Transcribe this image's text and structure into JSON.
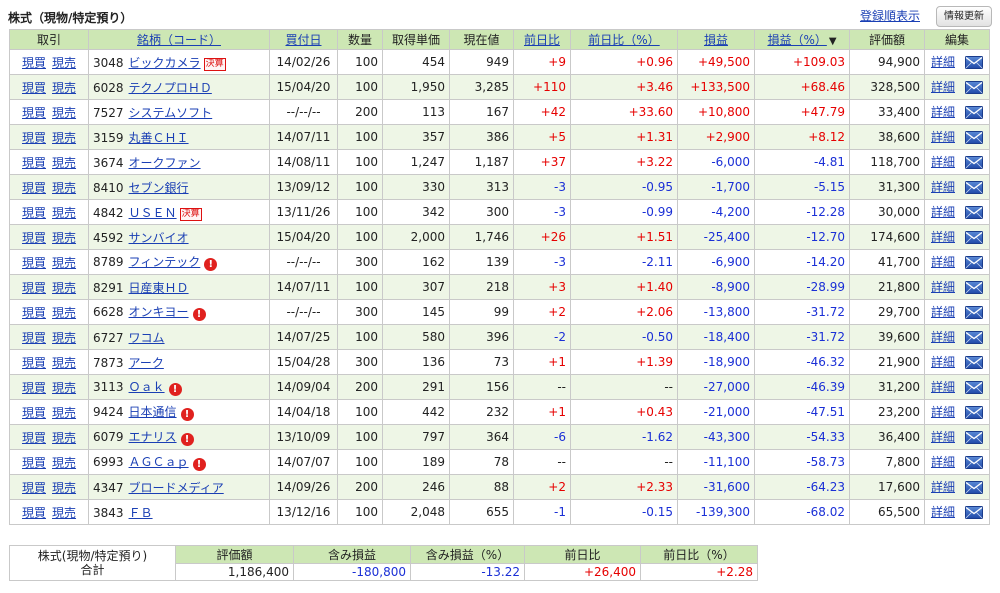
{
  "page": {
    "title": "株式（現物/特定預り）",
    "sort_link": "登録順表示",
    "refresh_button": "情報更新"
  },
  "columns": [
    "取引",
    "銘柄（コード）",
    "買付日",
    "数量",
    "取得単価",
    "現在値",
    "前日比",
    "前日比（%）",
    "損益",
    "損益（%）",
    "評価額",
    "編集"
  ],
  "sort_indicator": "▼",
  "trade_labels": {
    "buy": "現買",
    "sell": "現売"
  },
  "detail_label": "詳細",
  "settle_badge": "決算",
  "alert_symbol": "!",
  "rows": [
    {
      "code": "3048",
      "name": "ビックカメラ",
      "badge": "settle",
      "date": "14/02/26",
      "qty": "100",
      "cost": "454",
      "price": "949",
      "chg": "+9",
      "chg_pct": "+0.96",
      "pl": "+49,500",
      "pl_pct": "+109.03",
      "value": "94,900"
    },
    {
      "code": "6028",
      "name": "テクノプロＨＤ",
      "badge": "",
      "date": "15/04/20",
      "qty": "100",
      "cost": "1,950",
      "price": "3,285",
      "chg": "+110",
      "chg_pct": "+3.46",
      "pl": "+133,500",
      "pl_pct": "+68.46",
      "value": "328,500"
    },
    {
      "code": "7527",
      "name": "システムソフト",
      "badge": "",
      "date": "--/--/--",
      "qty": "200",
      "cost": "113",
      "price": "167",
      "chg": "+42",
      "chg_pct": "+33.60",
      "pl": "+10,800",
      "pl_pct": "+47.79",
      "value": "33,400"
    },
    {
      "code": "3159",
      "name": "丸善ＣＨＩ",
      "badge": "",
      "date": "14/07/11",
      "qty": "100",
      "cost": "357",
      "price": "386",
      "chg": "+5",
      "chg_pct": "+1.31",
      "pl": "+2,900",
      "pl_pct": "+8.12",
      "value": "38,600"
    },
    {
      "code": "3674",
      "name": "オークファン",
      "badge": "",
      "date": "14/08/11",
      "qty": "100",
      "cost": "1,247",
      "price": "1,187",
      "chg": "+37",
      "chg_pct": "+3.22",
      "pl": "-6,000",
      "pl_pct": "-4.81",
      "value": "118,700"
    },
    {
      "code": "8410",
      "name": "セブン銀行",
      "badge": "",
      "date": "13/09/12",
      "qty": "100",
      "cost": "330",
      "price": "313",
      "chg": "-3",
      "chg_pct": "-0.95",
      "pl": "-1,700",
      "pl_pct": "-5.15",
      "value": "31,300"
    },
    {
      "code": "4842",
      "name": "ＵＳＥＮ",
      "badge": "settle",
      "date": "13/11/26",
      "qty": "100",
      "cost": "342",
      "price": "300",
      "chg": "-3",
      "chg_pct": "-0.99",
      "pl": "-4,200",
      "pl_pct": "-12.28",
      "value": "30,000"
    },
    {
      "code": "4592",
      "name": "サンバイオ",
      "badge": "",
      "date": "15/04/20",
      "qty": "100",
      "cost": "2,000",
      "price": "1,746",
      "chg": "+26",
      "chg_pct": "+1.51",
      "pl": "-25,400",
      "pl_pct": "-12.70",
      "value": "174,600"
    },
    {
      "code": "8789",
      "name": "フィンテック",
      "badge": "alert",
      "date": "--/--/--",
      "qty": "300",
      "cost": "162",
      "price": "139",
      "chg": "-3",
      "chg_pct": "-2.11",
      "pl": "-6,900",
      "pl_pct": "-14.20",
      "value": "41,700"
    },
    {
      "code": "8291",
      "name": "日産東ＨＤ",
      "badge": "",
      "date": "14/07/11",
      "qty": "100",
      "cost": "307",
      "price": "218",
      "chg": "+3",
      "chg_pct": "+1.40",
      "pl": "-8,900",
      "pl_pct": "-28.99",
      "value": "21,800"
    },
    {
      "code": "6628",
      "name": "オンキヨー",
      "badge": "alert",
      "date": "--/--/--",
      "qty": "300",
      "cost": "145",
      "price": "99",
      "chg": "+2",
      "chg_pct": "+2.06",
      "pl": "-13,800",
      "pl_pct": "-31.72",
      "value": "29,700"
    },
    {
      "code": "6727",
      "name": "ワコム",
      "badge": "",
      "date": "14/07/25",
      "qty": "100",
      "cost": "580",
      "price": "396",
      "chg": "-2",
      "chg_pct": "-0.50",
      "pl": "-18,400",
      "pl_pct": "-31.72",
      "value": "39,600"
    },
    {
      "code": "7873",
      "name": "アーク",
      "badge": "",
      "date": "15/04/28",
      "qty": "300",
      "cost": "136",
      "price": "73",
      "chg": "+1",
      "chg_pct": "+1.39",
      "pl": "-18,900",
      "pl_pct": "-46.32",
      "value": "21,900"
    },
    {
      "code": "3113",
      "name": "Ｏａｋ",
      "badge": "alert",
      "date": "14/09/04",
      "qty": "200",
      "cost": "291",
      "price": "156",
      "chg": "--",
      "chg_pct": "--",
      "pl": "-27,000",
      "pl_pct": "-46.39",
      "value": "31,200"
    },
    {
      "code": "9424",
      "name": "日本通信",
      "badge": "alert",
      "date": "14/04/18",
      "qty": "100",
      "cost": "442",
      "price": "232",
      "chg": "+1",
      "chg_pct": "+0.43",
      "pl": "-21,000",
      "pl_pct": "-47.51",
      "value": "23,200"
    },
    {
      "code": "6079",
      "name": "エナリス",
      "badge": "alert",
      "date": "13/10/09",
      "qty": "100",
      "cost": "797",
      "price": "364",
      "chg": "-6",
      "chg_pct": "-1.62",
      "pl": "-43,300",
      "pl_pct": "-54.33",
      "value": "36,400"
    },
    {
      "code": "6993",
      "name": "ＡＧＣａｐ",
      "badge": "alert",
      "date": "14/07/07",
      "qty": "100",
      "cost": "189",
      "price": "78",
      "chg": "--",
      "chg_pct": "--",
      "pl": "-11,100",
      "pl_pct": "-58.73",
      "value": "7,800"
    },
    {
      "code": "4347",
      "name": "ブロードメディア",
      "badge": "",
      "date": "14/09/26",
      "qty": "200",
      "cost": "246",
      "price": "88",
      "chg": "+2",
      "chg_pct": "+2.33",
      "pl": "-31,600",
      "pl_pct": "-64.23",
      "value": "17,600"
    },
    {
      "code": "3843",
      "name": "ＦＢ",
      "badge": "",
      "date": "13/12/16",
      "qty": "100",
      "cost": "2,048",
      "price": "655",
      "chg": "-1",
      "chg_pct": "-0.15",
      "pl": "-139,300",
      "pl_pct": "-68.02",
      "value": "65,500"
    }
  ],
  "summary": {
    "label_line1": "株式(現物/特定預り)",
    "label_line2": "合計",
    "headers": [
      "評価額",
      "含み損益",
      "含み損益（%）",
      "前日比",
      "前日比（%）"
    ],
    "values": [
      "1,186,400",
      "-180,800",
      "-13.22",
      "+26,400",
      "+2.28"
    ]
  },
  "colors": {
    "header_bg": "#cde7b4",
    "row_alt_bg": "#eef6e6",
    "positive": "#e60000",
    "negative": "#1a2fd6",
    "link": "#1a3fb4"
  }
}
